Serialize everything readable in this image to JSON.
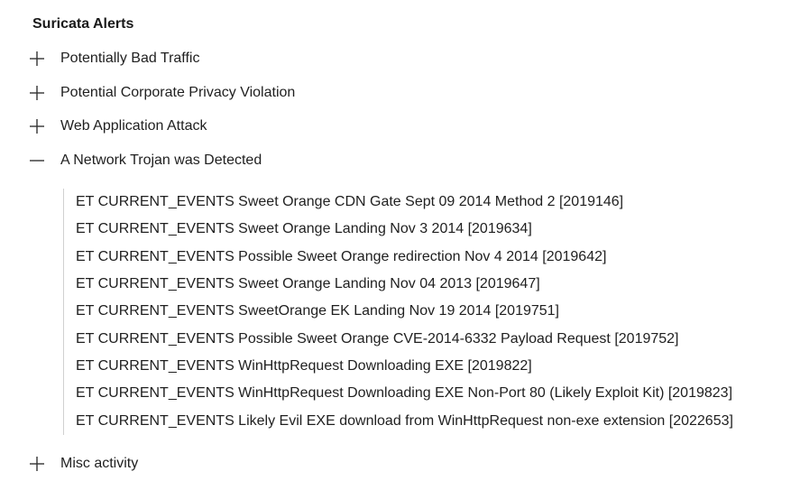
{
  "panel": {
    "title": "Suricata Alerts"
  },
  "categories": [
    {
      "label": "Potentially Bad Traffic",
      "expanded": false,
      "icon": "plus-icon"
    },
    {
      "label": "Potential Corporate Privacy Violation",
      "expanded": false,
      "icon": "plus-icon"
    },
    {
      "label": "Web Application Attack",
      "expanded": false,
      "icon": "plus-icon"
    },
    {
      "label": "A Network Trojan was Detected",
      "expanded": true,
      "icon": "minus-icon"
    },
    {
      "label": "Misc activity",
      "expanded": false,
      "icon": "plus-icon"
    }
  ],
  "alerts": [
    "ET CURRENT_EVENTS Sweet Orange CDN Gate Sept 09 2014 Method 2 [2019146]",
    "ET CURRENT_EVENTS Sweet Orange Landing Nov 3 2014 [2019634]",
    "ET CURRENT_EVENTS Possible Sweet Orange redirection Nov 4 2014 [2019642]",
    "ET CURRENT_EVENTS Sweet Orange Landing Nov 04 2013 [2019647]",
    "ET CURRENT_EVENTS SweetOrange EK Landing Nov 19 2014 [2019751]",
    "ET CURRENT_EVENTS Possible Sweet Orange CVE-2014-6332 Payload Request [2019752]",
    "ET CURRENT_EVENTS WinHttpRequest Downloading EXE [2019822]",
    "ET CURRENT_EVENTS WinHttpRequest Downloading EXE Non-Port 80 (Likely Exploit Kit) [2019823]",
    "ET CURRENT_EVENTS Likely Evil EXE download from WinHttpRequest non-exe extension [2022653]"
  ]
}
